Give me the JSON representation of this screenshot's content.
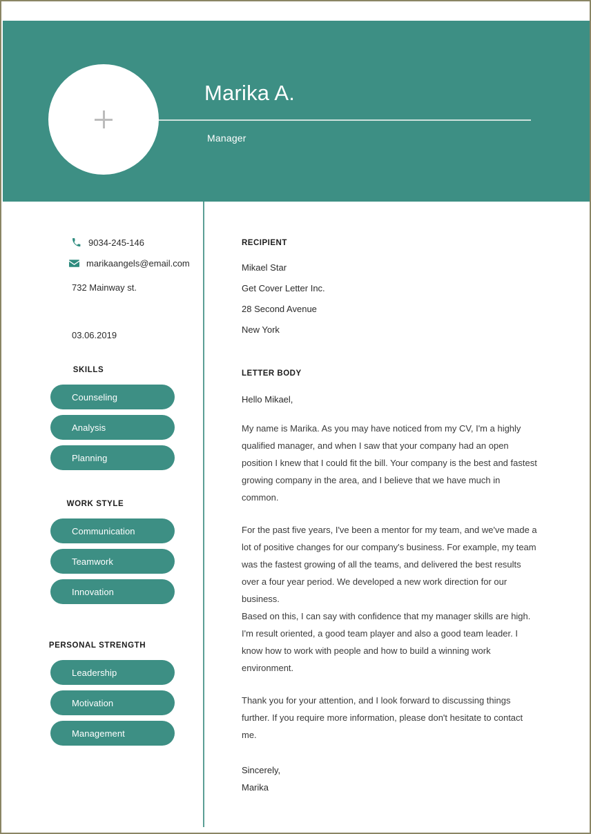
{
  "header": {
    "name": "Marika A.",
    "role": "Manager",
    "avatar_icon": "plus-icon",
    "background_color": "#3d8f84"
  },
  "sidebar": {
    "contact": {
      "phone": "9034-245-146",
      "phone_icon": "phone-icon",
      "email": "marikaangels@email.com",
      "email_icon": "envelope-icon",
      "address": "732 Mainway st.",
      "date": "03.06.2019"
    },
    "sections": [
      {
        "title": "SKILLS",
        "items": [
          "Counseling",
          "Analysis",
          "Planning"
        ]
      },
      {
        "title": "WORK STYLE",
        "items": [
          "Communication",
          "Teamwork",
          "Innovation"
        ]
      },
      {
        "title": "PERSONAL STRENGTH",
        "items": [
          "Leadership",
          "Motivation",
          "Management"
        ]
      }
    ]
  },
  "letter": {
    "recipient_label": "RECIPIENT",
    "recipient": [
      "Mikael Star",
      "Get Cover Letter Inc.",
      "28 Second Avenue",
      "New York"
    ],
    "body_label": "LETTER BODY",
    "greeting": "Hello Mikael,",
    "paragraphs": [
      "My name is Marika. As you may have noticed from my CV, I'm a highly qualified manager, and when I saw that your company had an open position I knew that I could fit the bill. Your company is the best and fastest growing company in the area, and I believe that we have much in common.",
      "For the past five years, I've been a mentor for my team, and we've made a lot of positive changes for our company's business. For example, my team was the fastest growing of all the teams, and delivered the best results over a four year period. We developed a new work direction for our business.",
      "Based on this, I can say with confidence that my manager skills are high. I'm result oriented, a good team player and also a good team leader. I know how to work with people and how to build a winning work environment.",
      "Thank you for your attention, and I look forward to discussing things further. If you require more information, please don't hesitate to contact me."
    ],
    "closing": "Sincerely,",
    "signature": "Marika"
  },
  "theme": {
    "accent": "#3d8f84",
    "divider": "#5a9e95",
    "page_border": "#8a8564"
  }
}
